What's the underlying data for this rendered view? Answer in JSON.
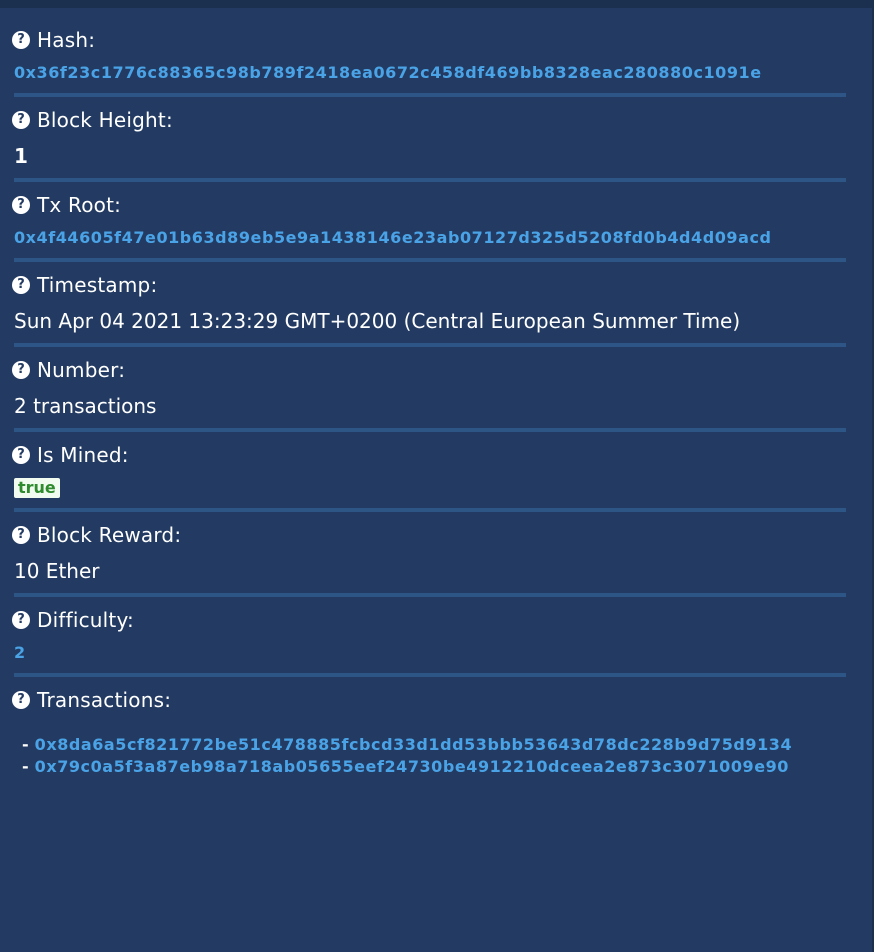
{
  "fields": {
    "hash": {
      "label": "Hash:",
      "value": "0x36f23c1776c88365c98b789f2418ea0672c458df469bb8328eac280880c1091e"
    },
    "block_height": {
      "label": "Block Height:",
      "value": "1"
    },
    "tx_root": {
      "label": "Tx Root:",
      "value": "0x4f44605f47e01b63d89eb5e9a1438146e23ab07127d325d5208fd0b4d4d09acd"
    },
    "timestamp": {
      "label": "Timestamp:",
      "value": "Sun Apr 04 2021 13:23:29 GMT+0200 (Central European Summer Time)"
    },
    "number": {
      "label": "Number:",
      "value": "2 transactions"
    },
    "is_mined": {
      "label": "Is Mined:",
      "value": "true"
    },
    "block_reward": {
      "label": "Block Reward:",
      "value": "10 Ether"
    },
    "difficulty": {
      "label": "Difficulty:",
      "value": "2"
    },
    "transactions": {
      "label": "Transactions:",
      "items": [
        "0x8da6a5cf821772be51c478885fcbcd33d1dd53bbb53643d78dc228b9d75d9134",
        "0x79c0a5f3a87eb98a718ab05655eef24730be4912210dceea2e873c3071009e90"
      ]
    }
  },
  "help_icon": "question-circle-icon",
  "colors": {
    "background": "#233b62",
    "link": "#4aa3e6",
    "divider": "#2d5585",
    "badge_bg": "#f2fbef",
    "badge_text": "#2e8b2e"
  }
}
